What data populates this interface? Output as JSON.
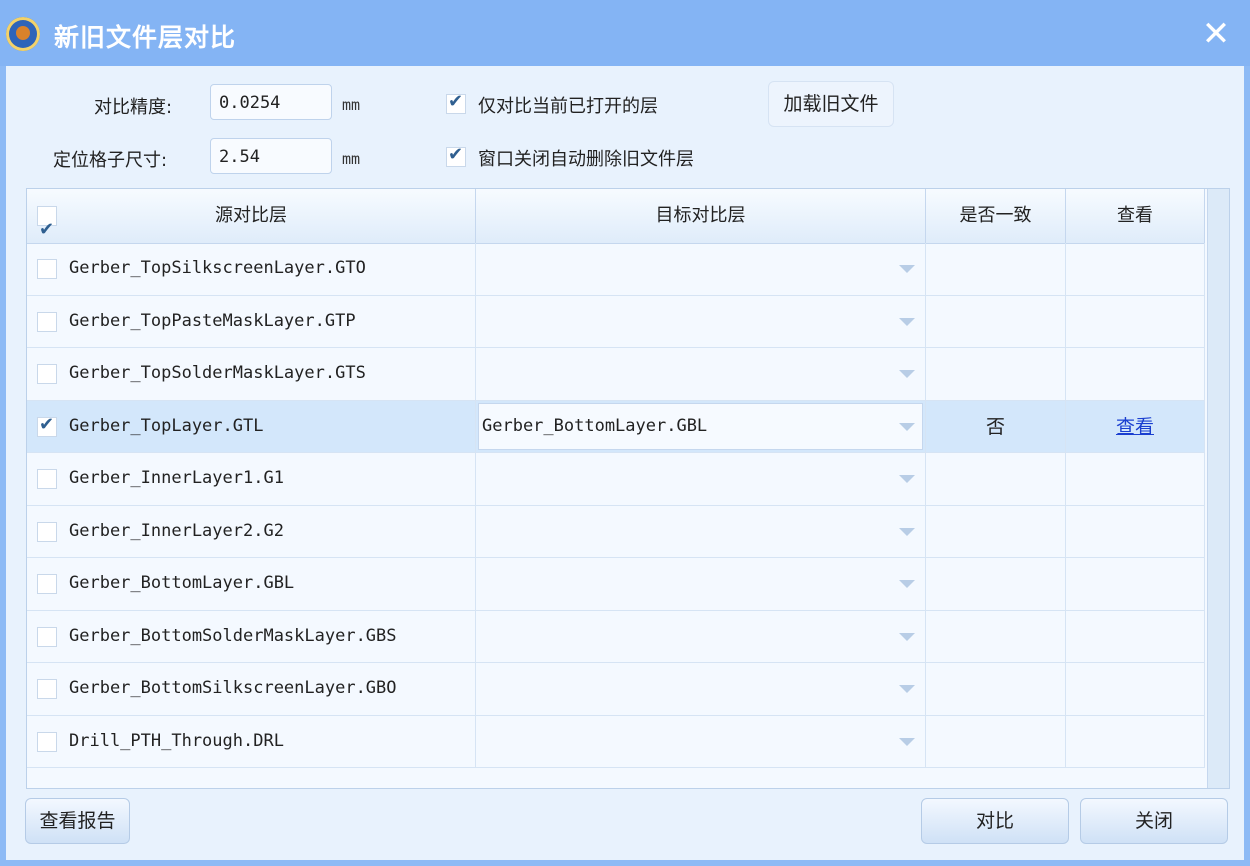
{
  "window": {
    "title": "新旧文件层对比",
    "close_glyph": "✕"
  },
  "settings": {
    "precision_label": "对比精度:",
    "precision_value": "0.0254",
    "grid_label": "定位格子尺寸:",
    "grid_value": "2.54",
    "unit": "mm",
    "only_open_label": "仅对比当前已打开的层",
    "only_open_checked": true,
    "auto_delete_label": "窗口关闭自动删除旧文件层",
    "auto_delete_checked": true,
    "load_old_button": "加载旧文件"
  },
  "table": {
    "headers": {
      "source": "源对比层",
      "target": "目标对比层",
      "match": "是否一致",
      "view": "查看"
    },
    "header_checked": true,
    "rows": [
      {
        "source": "Gerber_TopSilkscreenLayer.GTO",
        "checked": false,
        "target": "",
        "match": "",
        "view": ""
      },
      {
        "source": "Gerber_TopPasteMaskLayer.GTP",
        "checked": false,
        "target": "",
        "match": "",
        "view": ""
      },
      {
        "source": "Gerber_TopSolderMaskLayer.GTS",
        "checked": false,
        "target": "",
        "match": "",
        "view": ""
      },
      {
        "source": "Gerber_TopLayer.GTL",
        "checked": true,
        "target": "Gerber_BottomLayer.GBL",
        "match": "否",
        "view": "查看"
      },
      {
        "source": "Gerber_InnerLayer1.G1",
        "checked": false,
        "target": "",
        "match": "",
        "view": ""
      },
      {
        "source": "Gerber_InnerLayer2.G2",
        "checked": false,
        "target": "",
        "match": "",
        "view": ""
      },
      {
        "source": "Gerber_BottomLayer.GBL",
        "checked": false,
        "target": "",
        "match": "",
        "view": ""
      },
      {
        "source": "Gerber_BottomSolderMaskLayer.GBS",
        "checked": false,
        "target": "",
        "match": "",
        "view": ""
      },
      {
        "source": "Gerber_BottomSilkscreenLayer.GBO",
        "checked": false,
        "target": "",
        "match": "",
        "view": ""
      },
      {
        "source": "Drill_PTH_Through.DRL",
        "checked": false,
        "target": "",
        "match": "",
        "view": ""
      }
    ]
  },
  "footer": {
    "report_button": "查看报告",
    "compare_button": "对比",
    "close_button": "关闭"
  }
}
